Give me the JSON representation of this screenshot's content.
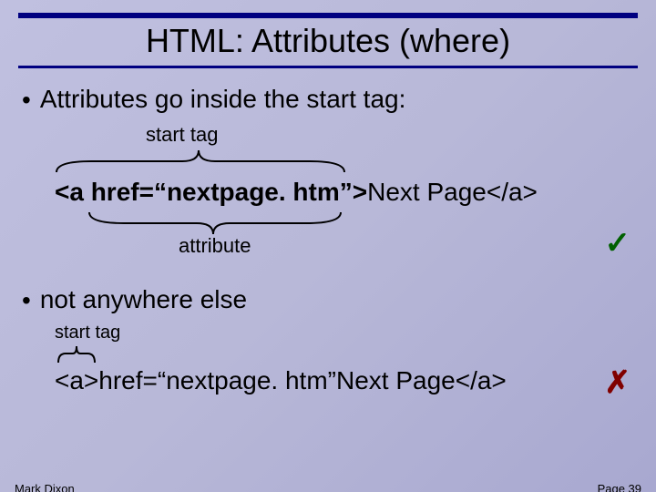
{
  "title": "HTML: Attributes (where)",
  "bullets": {
    "b1": "Attributes go inside the start tag:",
    "b2": "not anywhere else"
  },
  "example1": {
    "label_top": "start tag",
    "label_bottom": "attribute",
    "code_prefix": "<a href=“nextpage. htm”>",
    "code_suffix": "Next Page</a>",
    "mark": "✓"
  },
  "example2": {
    "label_top": "start tag",
    "code": "<a>href=“nextpage. htm”Next Page</a>",
    "mark": "✗"
  },
  "footer": {
    "author": "Mark Dixon",
    "page": "Page 39"
  }
}
